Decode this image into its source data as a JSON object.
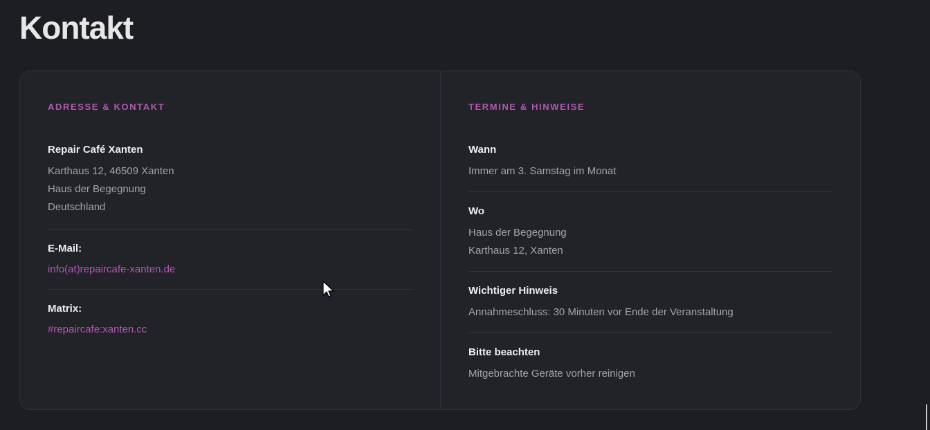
{
  "page": {
    "title": "Kontakt"
  },
  "left": {
    "heading": "Adresse & Kontakt",
    "org_name": "Repair Café Xanten",
    "address_lines": [
      "Karthaus 12, 46509 Xanten",
      "Haus der Begegnung",
      "Deutschland"
    ],
    "email_label": "E-Mail:",
    "email_value": "info(at)repaircafe-xanten.de",
    "matrix_label": "Matrix:",
    "matrix_value": "#repaircafe:xanten.cc"
  },
  "right": {
    "heading": "Termine & Hinweise",
    "items": [
      {
        "label": "Wann",
        "lines": [
          "Immer am 3. Samstag im Monat"
        ]
      },
      {
        "label": "Wo",
        "lines": [
          "Haus der Begegnung",
          "Karthaus 12, Xanten"
        ]
      },
      {
        "label": "Wichtiger Hinweis",
        "lines": [
          "Annahmeschluss: 30 Minuten vor Ende der Veranstaltung"
        ]
      },
      {
        "label": "Bitte beachten",
        "lines": [
          "Mitgebrachte Geräte vorher reinigen"
        ]
      }
    ]
  },
  "colors": {
    "accent": "#b457b0",
    "background": "#1c1e22",
    "card": "#212328"
  }
}
